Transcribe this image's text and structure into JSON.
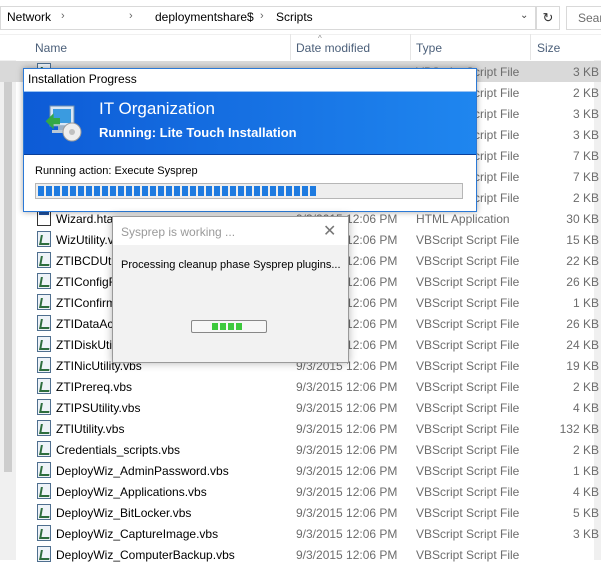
{
  "address": {
    "crumbs": [
      "Network",
      "deploymentshare$",
      "Scripts"
    ],
    "search_placeholder": "Sear"
  },
  "columns": {
    "name": "Name",
    "date": "Date modified",
    "type": "Type",
    "size": "Size"
  },
  "files": [
    {
      "name": "",
      "date": "",
      "type": "VBScript Script File",
      "size": "3 KB",
      "icon": "vbs-icon"
    },
    {
      "name": "",
      "date": "",
      "type": "VBScript Script File",
      "size": "2 KB",
      "icon": "vbs-icon"
    },
    {
      "name": "",
      "date": "",
      "type": "VBScript Script File",
      "size": "3 KB",
      "icon": "vbs-icon"
    },
    {
      "name": "",
      "date": "",
      "type": "VBScript Script File",
      "size": "3 KB",
      "icon": "vbs-icon"
    },
    {
      "name": "",
      "date": "",
      "type": "VBScript Script File",
      "size": "7 KB",
      "icon": "vbs-icon"
    },
    {
      "name": "",
      "date": "",
      "type": "VBScript Script File",
      "size": "7 KB",
      "icon": "vbs-icon"
    },
    {
      "name": "",
      "date": "",
      "type": "VBScript Script File",
      "size": "2 KB",
      "icon": "vbs-icon"
    },
    {
      "name": "Wizard.hta",
      "date": "9/3/2015 12:06 PM",
      "type": "HTML Application",
      "size": "30 KB",
      "icon": "hta-icon"
    },
    {
      "name": "WizUtility.vbs",
      "date": "9/3/2015 12:06 PM",
      "type": "VBScript Script File",
      "size": "15 KB",
      "icon": "vbs-icon"
    },
    {
      "name": "ZTIBCDUtility.vbs",
      "date": "9/3/2015 12:06 PM",
      "type": "VBScript Script File",
      "size": "22 KB",
      "icon": "vbs-icon"
    },
    {
      "name": "ZTIConfigFile.vbs",
      "date": "9/3/2015 12:06 PM",
      "type": "VBScript Script File",
      "size": "26 KB",
      "icon": "vbs-icon"
    },
    {
      "name": "ZTIConfirm.vbs",
      "date": "9/3/2015 12:06 PM",
      "type": "VBScript Script File",
      "size": "1 KB",
      "icon": "vbs-icon"
    },
    {
      "name": "ZTIDataAccess.vbs",
      "date": "9/3/2015 12:06 PM",
      "type": "VBScript Script File",
      "size": "26 KB",
      "icon": "vbs-icon"
    },
    {
      "name": "ZTIDiskUtility.vbs",
      "date": "9/3/2015 12:06 PM",
      "type": "VBScript Script File",
      "size": "24 KB",
      "icon": "vbs-icon"
    },
    {
      "name": "ZTINicUtility.vbs",
      "date": "9/3/2015 12:06 PM",
      "type": "VBScript Script File",
      "size": "19 KB",
      "icon": "vbs-icon"
    },
    {
      "name": "ZTIPrereq.vbs",
      "date": "9/3/2015 12:06 PM",
      "type": "VBScript Script File",
      "size": "2 KB",
      "icon": "vbs-icon"
    },
    {
      "name": "ZTIPSUtility.vbs",
      "date": "9/3/2015 12:06 PM",
      "type": "VBScript Script File",
      "size": "4 KB",
      "icon": "vbs-icon"
    },
    {
      "name": "ZTIUtility.vbs",
      "date": "9/3/2015 12:06 PM",
      "type": "VBScript Script File",
      "size": "132 KB",
      "icon": "vbs-icon"
    },
    {
      "name": "Credentials_scripts.vbs",
      "date": "9/3/2015 12:06 PM",
      "type": "VBScript Script File",
      "size": "2 KB",
      "icon": "vbs-icon"
    },
    {
      "name": "DeployWiz_AdminPassword.vbs",
      "date": "9/3/2015 12:06 PM",
      "type": "VBScript Script File",
      "size": "1 KB",
      "icon": "vbs-icon"
    },
    {
      "name": "DeployWiz_Applications.vbs",
      "date": "9/3/2015 12:06 PM",
      "type": "VBScript Script File",
      "size": "4 KB",
      "icon": "vbs-icon"
    },
    {
      "name": "DeployWiz_BitLocker.vbs",
      "date": "9/3/2015 12:06 PM",
      "type": "VBScript Script File",
      "size": "5 KB",
      "icon": "vbs-icon"
    },
    {
      "name": "DeployWiz_CaptureImage.vbs",
      "date": "9/3/2015 12:06 PM",
      "type": "VBScript Script File",
      "size": "3 KB",
      "icon": "vbs-icon"
    },
    {
      "name": "DeployWiz_ComputerBackup.vbs",
      "date": "9/3/2015 12:06 PM",
      "type": "VBScript Script File",
      "size": "",
      "icon": "vbs-icon"
    }
  ],
  "install_progress": {
    "title": "Installation Progress",
    "org": "IT Organization",
    "status": "Running: Lite Touch Installation",
    "action": "Running action: Execute Sysprep",
    "progress_fraction": 0.66
  },
  "sysprep": {
    "title": "Sysprep is working ...",
    "message": "Processing cleanup phase Sysprep plugins..."
  },
  "colors": {
    "banner": "#1c73e6",
    "progress": "#1e7be0",
    "marquee": "#3dc93d"
  }
}
